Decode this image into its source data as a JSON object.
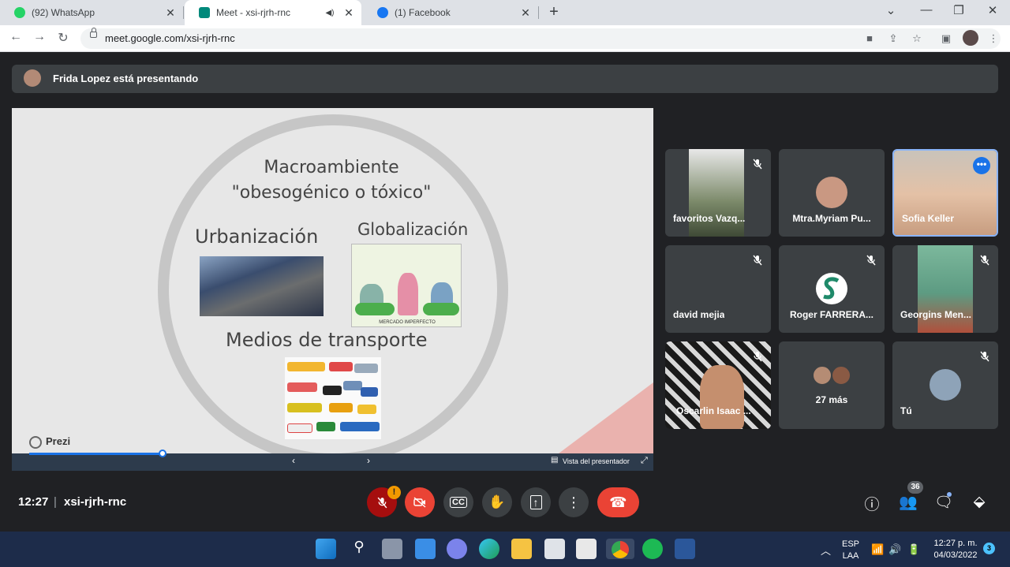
{
  "browser": {
    "tabs": [
      {
        "label": "(92) WhatsApp",
        "icon": "whatsapp-icon",
        "color": "#25d366",
        "badge": "92"
      },
      {
        "label": "Meet - xsi-rjrh-rnc",
        "icon": "google-meet-icon",
        "color": "#00897b",
        "active": true
      },
      {
        "label": "(1) Facebook",
        "icon": "facebook-icon",
        "color": "#1877f2"
      }
    ],
    "new_tab": "+",
    "url": "meet.google.com/xsi-rjrh-rnc"
  },
  "meet": {
    "presenting_banner": "Frida Lopez está presentando",
    "slide": {
      "title_line1": "Macroambiente",
      "title_line2": "\"obesogénico o tóxico\"",
      "label_urban": "Urbanización",
      "label_glob": "Globalización",
      "label_transport": "Medios de transporte",
      "glob_caption": "MERCADO IMPERFECTO",
      "prezi_label": "Prezi",
      "presenter_view": "Vista del presentador"
    },
    "participants": [
      {
        "name": "favoritos Vazq...",
        "muted": true,
        "kind": "video",
        "color": "#6c7a5a"
      },
      {
        "name": "Mtra.Myriam Pu...",
        "muted": false,
        "kind": "avatar",
        "color": "#c99882"
      },
      {
        "name": "Sofia Keller",
        "muted": false,
        "kind": "video",
        "color": "#d8b39b",
        "speaking": true
      },
      {
        "name": "david mejia",
        "muted": true,
        "kind": "none",
        "color": "#3c4043"
      },
      {
        "name": "Roger FARRERA...",
        "muted": true,
        "kind": "avatar",
        "color": "#ffffff"
      },
      {
        "name": "Georgins Men...",
        "muted": true,
        "kind": "video",
        "color": "#6aa58c"
      },
      {
        "name": "Oscarlin Isaac ...",
        "muted": true,
        "kind": "video",
        "color": "#222222"
      },
      {
        "name": "27 más",
        "muted": false,
        "kind": "group",
        "color": "#b58c74"
      },
      {
        "name": "Tú",
        "muted": true,
        "kind": "avatar",
        "color": "#8ea3b8"
      }
    ],
    "time": "12:27",
    "separator": "|",
    "meeting_code": "xsi-rjrh-rnc",
    "mic_warning": "!",
    "participants_count": "36"
  },
  "taskbar": {
    "lang_line1": "ESP",
    "lang_line2": "LAA",
    "clock_time": "12:27 p. m.",
    "clock_date": "04/03/2022",
    "notifications": "3"
  },
  "colors": {
    "meet_bg": "#202124",
    "tile_bg": "#3c4043",
    "end_call": "#ea4335",
    "accent": "#1a73e8"
  }
}
